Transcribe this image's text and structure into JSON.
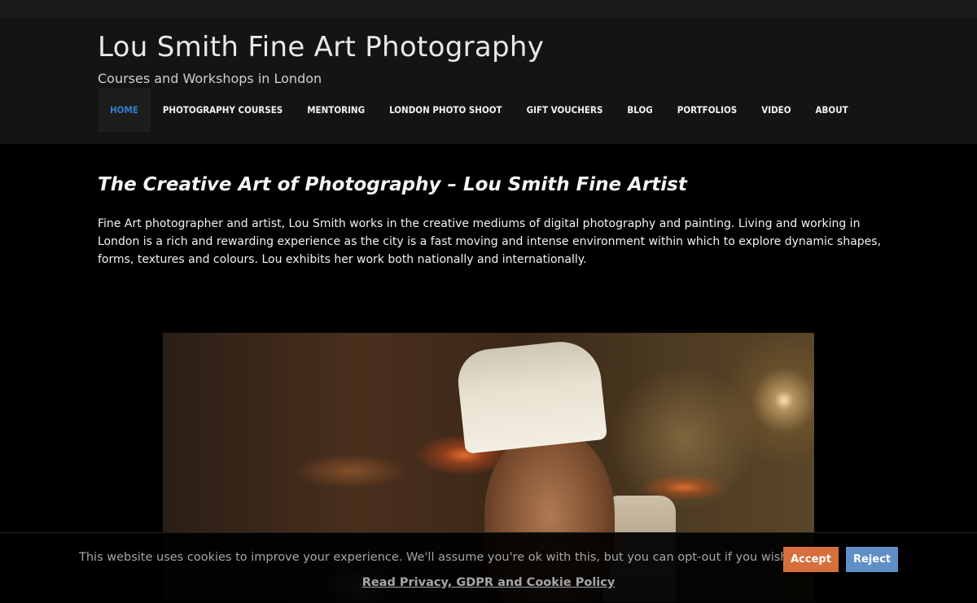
{
  "header": {
    "site_title": "Lou Smith Fine Art Photography",
    "tagline": "Courses and Workshops in London"
  },
  "nav": {
    "items": [
      {
        "label": "HOME",
        "active": true
      },
      {
        "label": "PHOTOGRAPHY COURSES"
      },
      {
        "label": "MENTORING"
      },
      {
        "label": "LONDON PHOTO SHOOT"
      },
      {
        "label": "GIFT VOUCHERS"
      },
      {
        "label": "BLOG"
      },
      {
        "label": "PORTFOLIOS"
      },
      {
        "label": "VIDEO"
      },
      {
        "label": "ABOUT"
      }
    ]
  },
  "main": {
    "heading": "The Creative Art of Photography – Lou Smith Fine Artist",
    "intro": "Fine Art photographer and artist, Lou Smith works in the creative mediums of digital photography and painting.  Living and working in London is a rich and rewarding experience as the city is a fast moving and intense environment within which to explore dynamic shapes, forms, textures and colours. Lou exhibits her work both nationally and internationally."
  },
  "cookie_bar": {
    "message": "This website uses cookies to improve your experience. We'll assume you're ok with this, but you can opt-out if you wish.",
    "accept_label": "Accept",
    "reject_label": "Reject",
    "policy_link": "Read Privacy, GDPR and Cookie Policy"
  },
  "colors": {
    "nav_active": "#2e7fd1",
    "accept_button": "#d66f3c",
    "reject_button": "#5f8fc7"
  }
}
